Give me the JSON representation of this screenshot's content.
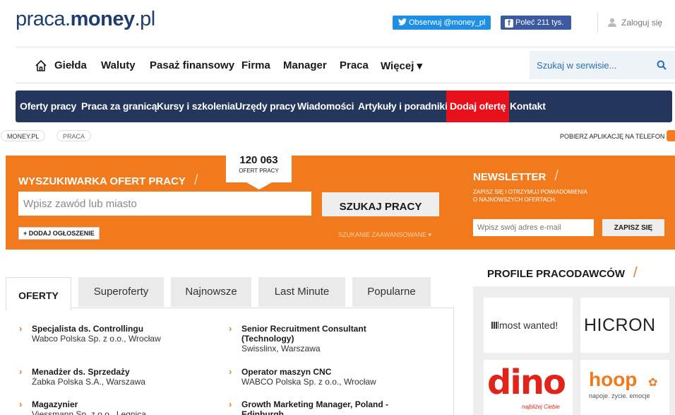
{
  "header": {
    "logo_light": "praca.",
    "logo_bold": "money",
    "logo_suffix": ".pl",
    "twitter": "Obserwuj @money_pl",
    "facebook": "Poleć 211 tys.",
    "login": "Zaloguj się"
  },
  "mainnav": {
    "items": [
      "Giełda",
      "Waluty",
      "Pasaż finansowy",
      "Firma",
      "Manager",
      "Praca",
      "Więcej ▾"
    ],
    "search_placeholder": "Szukaj w serwisie..."
  },
  "subnav": {
    "items": [
      "Oferty pracy",
      "Praca za granicą",
      "Kursy i szkolenia",
      "Urzędy pracy",
      "Wiadomości",
      "Artykuły i poradniki",
      "Dodaj ofertę",
      "Kontakt"
    ]
  },
  "breadcrumb": [
    "MONEY.PL",
    "PRACA"
  ],
  "app_link": "POBIERZ APLIKACJĘ NA TELEFON",
  "search": {
    "counter_number": "120 063",
    "counter_label": "OFERT PRACY",
    "title": "WYSZUKIWARKA OFERT PRACY",
    "placeholder": "Wpisz zawód lub miasto",
    "button": "SZUKAJ PRACY",
    "add_offer": "+ DODAJ OGŁOSZENIE",
    "advanced": "SZUKANIE ZAAWANSOWANE ▾"
  },
  "newsletter": {
    "title": "NEWSLETTER",
    "desc_line1": "ZAPISZ SIĘ I OTRZYMUJ POWIADOMIENIA",
    "desc_line2": "O NAJNOWSZYCH OFERTACH.",
    "placeholder": "Wpisz swój adres e-mail",
    "button": "ZAPISZ SIĘ"
  },
  "tabs": [
    "OFERTY",
    "Superoferty",
    "Najnowsze",
    "Last Minute",
    "Popularne"
  ],
  "offers": [
    {
      "title": "Specjalista ds. Controllingu",
      "company": "Wabco Polska Sp. z o.o., Wrocław"
    },
    {
      "title": "Senior Recruitment Consultant (Technology)",
      "company": "Swisslinx, Warszawa"
    },
    {
      "title": "Menadżer ds. Sprzedaży",
      "company": "Żabka Polska S.A., Warszawa"
    },
    {
      "title": "Operator maszyn CNC",
      "company": "WABCO Polska Sp. z o.o., Wrocław"
    },
    {
      "title": "Magazynier",
      "company": "Viessmann Sp. z o.o., Legnica"
    },
    {
      "title": "Growth Marketing Manager, Poland - Edinburgh",
      "company": ""
    }
  ],
  "profiles": {
    "title": "PROFILE PRACODAWCÓW",
    "logos": [
      {
        "name": "most wanted!",
        "color": "#333333"
      },
      {
        "name": "HICRON",
        "color": "#222222"
      },
      {
        "name": "dino",
        "tagline": "najbliżej Ciebie",
        "color": "#e2231a"
      },
      {
        "name": "hoop",
        "tagline": "napoje. życie. emocje",
        "color": "#f07a1c"
      }
    ]
  }
}
